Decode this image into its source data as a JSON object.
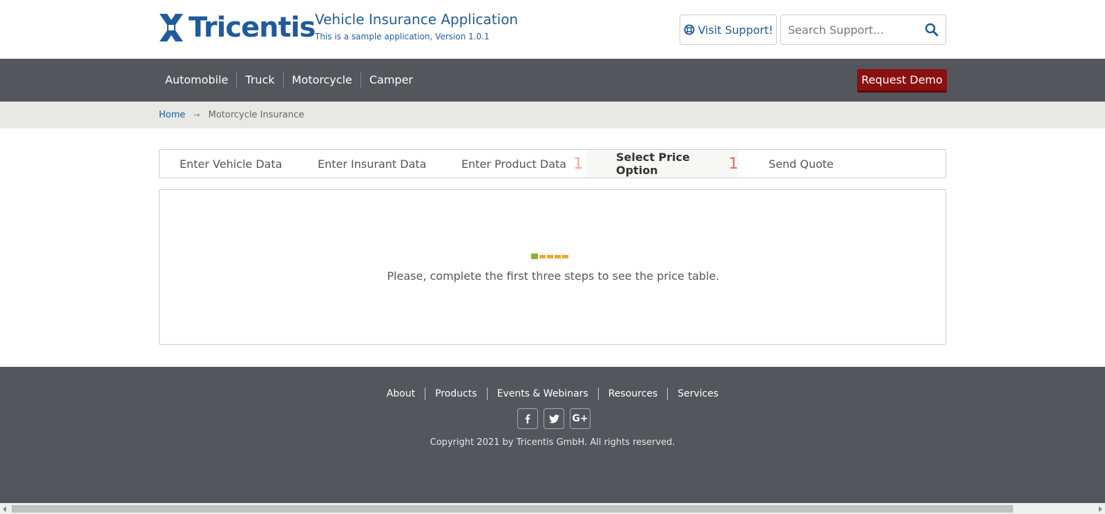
{
  "header": {
    "logo_text": "Tricentis",
    "app_title": "Vehicle Insurance Application",
    "app_subtitle": "This is a sample application, Version 1.0.1",
    "support_label": "Visit Support!",
    "search_placeholder": "Search Support...",
    "icons": {
      "support": "lifebuoy-icon",
      "search": "search-icon"
    }
  },
  "nav": {
    "items": [
      "Automobile",
      "Truck",
      "Motorcycle",
      "Camper"
    ],
    "demo_label": "Request Demo"
  },
  "breadcrumb": {
    "home": "Home",
    "separator": "→",
    "current": "Motorcycle Insurance"
  },
  "tabs": [
    {
      "label": "Enter Vehicle Data",
      "count": ""
    },
    {
      "label": "Enter Insurant Data",
      "count": ""
    },
    {
      "label": "Enter Product Data",
      "count": "1"
    },
    {
      "label": "Select Price Option",
      "count": "1",
      "active": true
    },
    {
      "label": "Send Quote",
      "count": ""
    }
  ],
  "panel": {
    "message": "Please, complete the first three steps to see the price table."
  },
  "footer": {
    "links": [
      "About",
      "Products",
      "Events & Webinars",
      "Resources",
      "Services"
    ],
    "social": [
      {
        "icon": "facebook-icon",
        "glyph": "f"
      },
      {
        "icon": "twitter-icon",
        "glyph": "t"
      },
      {
        "icon": "google-plus-icon",
        "glyph": "G+"
      }
    ],
    "copyright": "Copyright 2021 by Tricentis GmbH. All rights reserved."
  },
  "colors": {
    "brand_blue": "#1f5b9c",
    "nav_bg": "#53565b",
    "demo_red": "#8b1010",
    "breadcrumb_bg": "#e8e8e4",
    "badge": "#e06a5a",
    "loader_green": "#8bb02e",
    "loader_orange": "#f0a629"
  }
}
